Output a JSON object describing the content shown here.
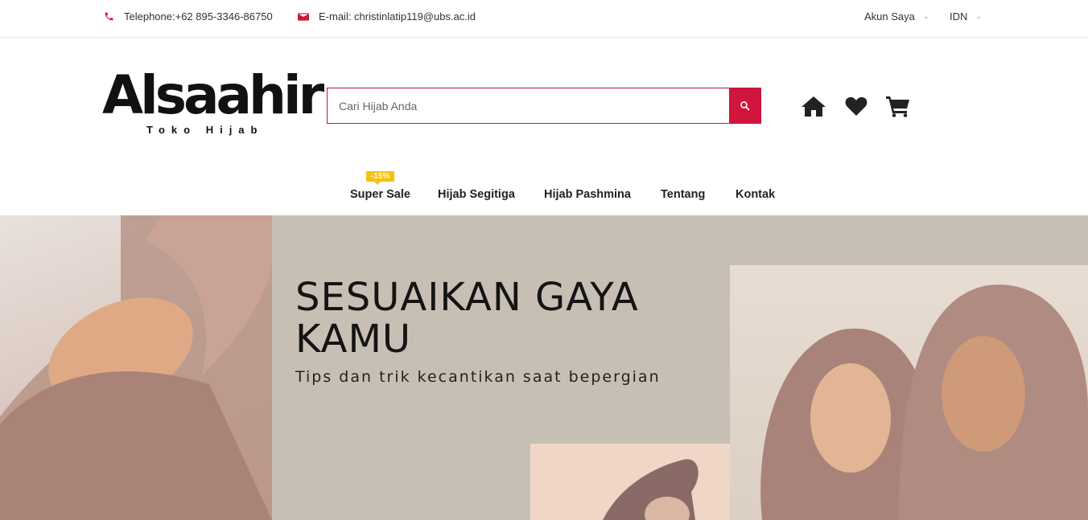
{
  "topbar": {
    "phone": "Telephone:+62 895-3346-86750",
    "email": "E-mail: christinlatip119@ubs.ac.id",
    "account": "Akun Saya",
    "language": "IDN"
  },
  "brand": {
    "name": "Alsaahir",
    "tagline": "Toko Hijab"
  },
  "search": {
    "placeholder": "Cari Hijab Anda",
    "value": ""
  },
  "nav": {
    "badge": "-15%",
    "items": [
      "Super Sale",
      "Hijab Segitiga",
      "Hijab Pashmina",
      "Tentang",
      "Kontak"
    ]
  },
  "banner": {
    "title": "SESUAIKAN GAYA KAMU",
    "subtitle": "Tips dan trik kecantikan saat bepergian"
  },
  "colors": {
    "accent": "#d0163e",
    "badge": "#f6c111",
    "banner_bg": "#c8bfb4"
  }
}
